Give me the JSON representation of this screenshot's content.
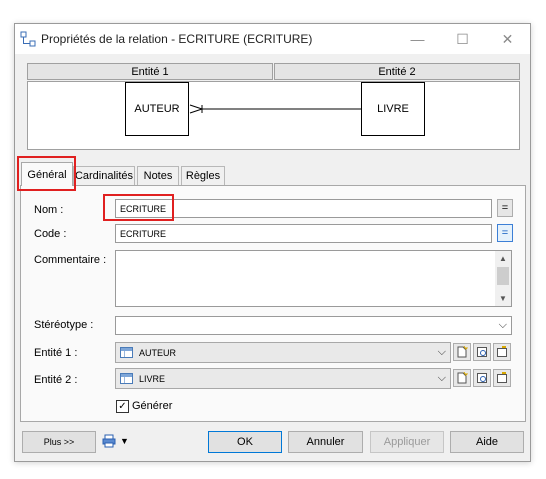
{
  "window": {
    "title": "Propriétés de la relation - ECRITURE (ECRITURE)",
    "minimize_glyph": "—",
    "maximize_glyph": "☐",
    "close_glyph": "✕",
    "title_icon": "relation-properties-icon"
  },
  "columns": {
    "left": "Entité 1",
    "right": "Entité 2"
  },
  "diagram": {
    "entity1": "AUTEUR",
    "entity2": "LIVRE",
    "link_color": "#000000"
  },
  "tabs": [
    {
      "label": "Général",
      "active": true
    },
    {
      "label": "Cardinalités",
      "active": false
    },
    {
      "label": "Notes",
      "active": false
    },
    {
      "label": "Règles",
      "active": false
    }
  ],
  "form": {
    "name_label": "Nom :",
    "name_value": "ECRITURE",
    "code_label": "Code :",
    "code_value": "ECRITURE",
    "equals_glyph": "=",
    "comment_label": "Commentaire :",
    "comment_value": "",
    "stereotype_label": "Stéréotype :",
    "stereotype_value": "",
    "entity1_label": "Entité 1 :",
    "entity1_value": "AUTEUR",
    "entity2_label": "Entité 2 :",
    "entity2_value": "LIVRE",
    "generate_label": "Générer",
    "generate_checked": true
  },
  "footer": {
    "more_label": "Plus >>",
    "ok_label": "OK",
    "cancel_label": "Annuler",
    "apply_label": "Appliquer",
    "help_label": "Aide"
  },
  "colors": {
    "highlight": "#e02020",
    "accent": "#0078d7"
  }
}
